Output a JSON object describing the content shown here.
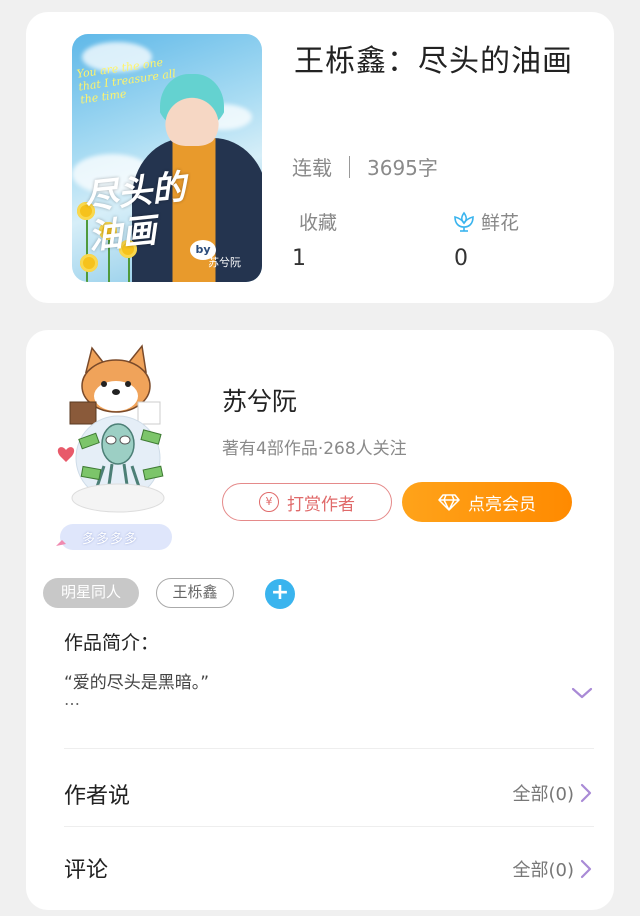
{
  "book": {
    "title": "王栎鑫：尽头的油画",
    "status": "连载",
    "word_count": "3695字",
    "favorites_label": "收藏",
    "favorites_value": "1",
    "flowers_label": "鲜花",
    "flowers_value": "0",
    "cover": {
      "english_text": "You are the one that I treasure all the time",
      "title_text": "尽头的油画",
      "by_text": "by",
      "author_text": "苏兮阮"
    }
  },
  "author": {
    "name": "苏兮阮",
    "stats": "著有4部作品·268人关注",
    "avatar_caption": "多多多多",
    "tip_button": "打赏作者",
    "vip_button": "点亮会员"
  },
  "tags": [
    "明星同人",
    "王栎鑫"
  ],
  "intro": {
    "label": "作品简介：",
    "text": "“爱的尽头是黑暗。”",
    "ellipsis": "…"
  },
  "sections": {
    "author_says": {
      "label": "作者说",
      "link": "全部(0)"
    },
    "comments": {
      "label": "评论",
      "link": "全部(0)"
    }
  },
  "colors": {
    "accent_purple": "#a98ad6",
    "tip_red": "#e06a6a",
    "vip_orange": "#ff9500",
    "tag_blue": "#3ab4ee"
  }
}
